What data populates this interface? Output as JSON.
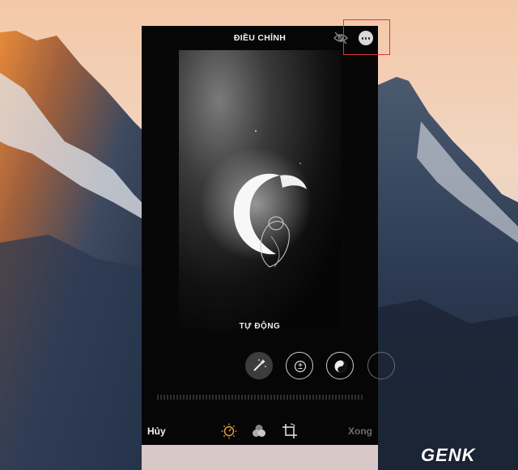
{
  "header": {
    "title": "ĐIỀU CHỈNH"
  },
  "icons": {
    "eye": "eye-slash-icon",
    "more": "more-icon",
    "auto": "magic-wand-icon",
    "exposure": "exposure-icon",
    "brilliance": "brilliance-icon",
    "adjust": "adjust-dial-icon",
    "filters": "filters-icon",
    "crop": "crop-rotate-icon"
  },
  "editor": {
    "mode_label": "TỰ ĐỘNG"
  },
  "footer": {
    "cancel_label": "Hủy",
    "done_label": "Xong"
  },
  "watermark": {
    "text": "GENK"
  },
  "colors": {
    "highlight": "#e0343a",
    "accent_orange": "#f0a23a",
    "done_disabled": "#6c6c6c"
  }
}
